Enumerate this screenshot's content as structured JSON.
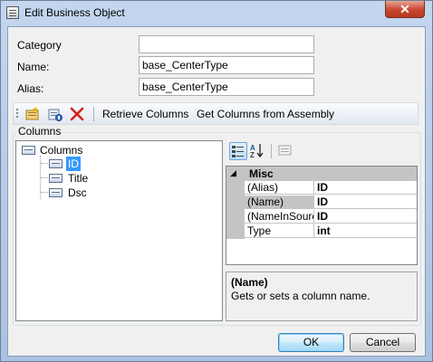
{
  "window": {
    "title": "Edit Business Object",
    "close_label": "✕"
  },
  "form": {
    "category_label": "Category",
    "category_value": "",
    "name_label": "Name:",
    "name_value": "base_CenterType",
    "alias_label": "Alias:",
    "alias_value": "base_CenterType"
  },
  "toolbar": {
    "retrieve_columns": "Retrieve Columns",
    "get_columns_from_assembly": "Get Columns from Assembly"
  },
  "columns_group": {
    "caption": "Columns",
    "root": "Columns",
    "items": [
      "ID",
      "Title",
      "Dsc"
    ],
    "selected": "ID"
  },
  "property_grid": {
    "category": "Misc",
    "rows": [
      {
        "name": "(Alias)",
        "value": "ID"
      },
      {
        "name": "(Name)",
        "value": "ID"
      },
      {
        "name": "(NameInSource)",
        "value": "ID"
      },
      {
        "name": "Type",
        "value": "int"
      }
    ],
    "selected_property": "(Name)",
    "help_title": "(Name)",
    "help_description": "Gets or sets a column name."
  },
  "buttons": {
    "ok": "OK",
    "cancel": "Cancel"
  }
}
